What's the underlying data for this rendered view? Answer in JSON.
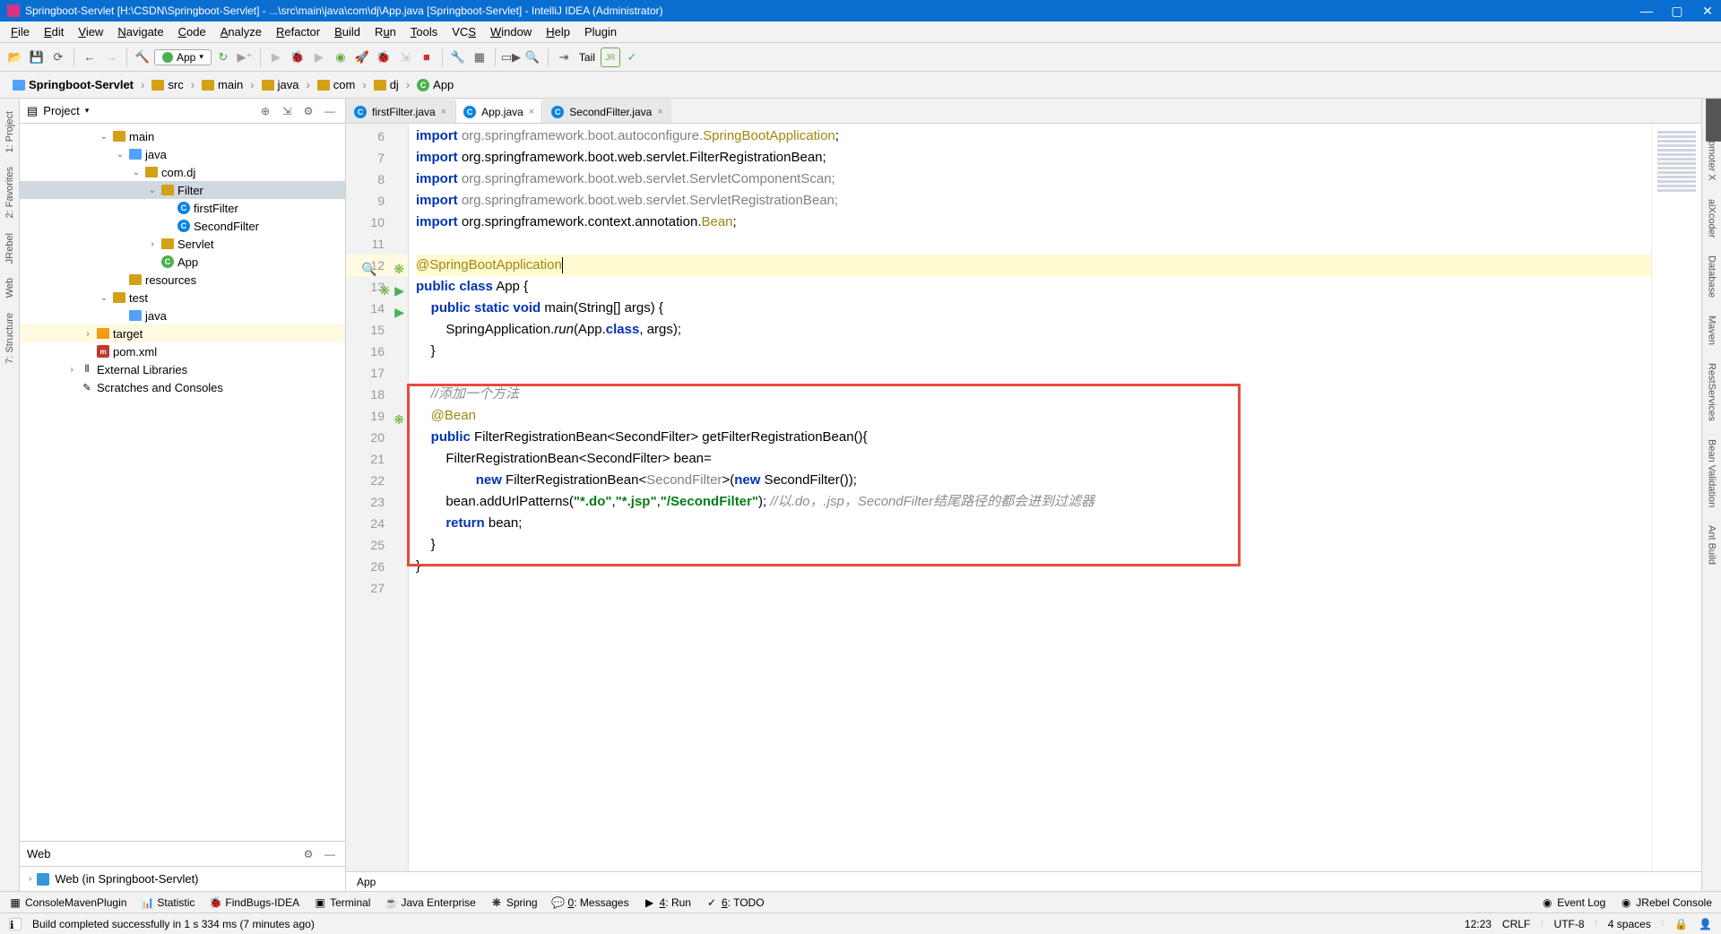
{
  "titlebar": {
    "title": "Springboot-Servlet [H:\\CSDN\\Springboot-Servlet] - ...\\src\\main\\java\\com\\dj\\App.java [Springboot-Servlet] - IntelliJ IDEA (Administrator)"
  },
  "menu": [
    "File",
    "Edit",
    "View",
    "Navigate",
    "Code",
    "Analyze",
    "Refactor",
    "Build",
    "Run",
    "Tools",
    "VCS",
    "Window",
    "Help",
    "Plugin"
  ],
  "menu_underlines": [
    0,
    0,
    0,
    0,
    0,
    0,
    0,
    0,
    1,
    0,
    2,
    0,
    0,
    -1
  ],
  "toolbar": {
    "run_config": "App",
    "tail": "Tail"
  },
  "breadcrumb": [
    "Springboot-Servlet",
    "src",
    "main",
    "java",
    "com",
    "dj",
    "App"
  ],
  "project_panel": {
    "title": "Project",
    "tree": [
      {
        "depth": 0,
        "chev": "v",
        "icon": "folder",
        "label": "main"
      },
      {
        "depth": 1,
        "chev": "v",
        "icon": "folder-blue",
        "label": "java"
      },
      {
        "depth": 2,
        "chev": "v",
        "icon": "folder",
        "label": "com.dj"
      },
      {
        "depth": 3,
        "chev": "v",
        "icon": "folder",
        "label": "Filter",
        "selected": true
      },
      {
        "depth": 4,
        "chev": "",
        "icon": "class",
        "label": "firstFilter"
      },
      {
        "depth": 4,
        "chev": "",
        "icon": "class",
        "label": "SecondFilter"
      },
      {
        "depth": 3,
        "chev": ">",
        "icon": "folder",
        "label": "Servlet"
      },
      {
        "depth": 3,
        "chev": "",
        "icon": "class-g",
        "label": "App"
      },
      {
        "depth": 1,
        "chev": "",
        "icon": "folder",
        "label": "resources"
      },
      {
        "depth": 0,
        "chev": "v",
        "icon": "folder",
        "label": "test"
      },
      {
        "depth": 1,
        "chev": "",
        "icon": "folder-blue",
        "label": "java"
      },
      {
        "depth": -1,
        "chev": ">",
        "icon": "folder-orange",
        "label": "target",
        "seltint": true
      },
      {
        "depth": -1,
        "chev": "",
        "icon": "maven",
        "label": "pom.xml"
      },
      {
        "depth": -2,
        "chev": ">",
        "icon": "lib",
        "label": "External Libraries"
      },
      {
        "depth": -2,
        "chev": "",
        "icon": "scratch",
        "label": "Scratches and Consoles"
      }
    ],
    "web_title": "Web",
    "web_item": "Web (in Springboot-Servlet)"
  },
  "left_rail": [
    "1: Project",
    "2: Favorites",
    "JRebel",
    "Web",
    "7: Structure"
  ],
  "right_rail": [
    "Key Promoter X",
    "aiXcoder",
    "Database",
    "Maven",
    "RestServices",
    "Bean Validation",
    "Ant Build"
  ],
  "editor": {
    "tabs": [
      {
        "label": "firstFilter.java",
        "active": false
      },
      {
        "label": "App.java",
        "active": true
      },
      {
        "label": "SecondFilter.java",
        "active": false
      }
    ],
    "first_line": 6,
    "lines": [
      {
        "n": 6,
        "html": "<span class='kw'>import</span> <span class='unused'>org.springframework.boot.autoconfigure.</span><span class='ann'>SpringBootApplication</span>;"
      },
      {
        "n": 7,
        "html": "<span class='kw'>import</span> org.springframework.boot.web.servlet.FilterRegistrationBean;"
      },
      {
        "n": 8,
        "html": "<span class='kw'>import</span> <span class='unused'>org.springframework.boot.web.servlet.ServletComponentScan;</span>"
      },
      {
        "n": 9,
        "html": "<span class='kw'>import</span> <span class='unused'>org.springframework.boot.web.servlet.ServletRegistrationBean;</span>"
      },
      {
        "n": 10,
        "html": "<span class='kw'>import</span> org.springframework.context.annotation.<span class='ann'>Bean</span>;"
      },
      {
        "n": 11,
        "html": ""
      },
      {
        "n": 12,
        "html": "<span class='ann'>@SpringBootApplication</span><span class='caret'></span>",
        "hl": true,
        "gut": "lens spring"
      },
      {
        "n": 13,
        "html": "<span class='kw'>public class</span> App {",
        "gut": "spring run"
      },
      {
        "n": 14,
        "html": "    <span class='kw'>public static void</span> main(String[] args) {",
        "gut": "run"
      },
      {
        "n": 15,
        "html": "        SpringApplication.<span class='italic-call'>run</span>(App.<span class='kw'>class</span>, args);"
      },
      {
        "n": 16,
        "html": "    }"
      },
      {
        "n": 17,
        "html": ""
      },
      {
        "n": 18,
        "html": "    <span class='cmt'>//添加一个方法</span>"
      },
      {
        "n": 19,
        "html": "    <span class='ann'>@Bean</span>",
        "gut": "spring"
      },
      {
        "n": 20,
        "html": "    <span class='kw'>public</span> FilterRegistrationBean&lt;SecondFilter&gt; getFilterRegistrationBean(){"
      },
      {
        "n": 21,
        "html": "        FilterRegistrationBean&lt;SecondFilter&gt; bean="
      },
      {
        "n": 22,
        "html": "                <span class='kw'>new</span> FilterRegistrationBean&lt;<span class='unused'>SecondFilter</span>&gt;(<span class='kw'>new</span> SecondFilter());"
      },
      {
        "n": 23,
        "html": "        bean.addUrlPatterns(<span class='str'>\"*.do\"</span>,<span class='str'>\"*.jsp\"</span>,<span class='str'>\"/SecondFilter\"</span>); <span class='cmt'>//以.do，.jsp，SecondFilter结尾路径的都会进到过滤器</span>"
      },
      {
        "n": 24,
        "html": "        <span class='kw'>return</span> bean;"
      },
      {
        "n": 25,
        "html": "    }"
      },
      {
        "n": 26,
        "html": "}"
      },
      {
        "n": 27,
        "html": ""
      }
    ],
    "crumb": "App"
  },
  "bottom_bar": [
    "ConsoleMavenPlugin",
    "Statistic",
    "FindBugs-IDEA",
    "Terminal",
    "Java Enterprise",
    "Spring",
    "0: Messages",
    "4: Run",
    "6: TODO"
  ],
  "bottom_bar_right": [
    "Event Log",
    "JRebel Console"
  ],
  "status": {
    "msg": "Build completed successfully in 1 s 334 ms (7 minutes ago)",
    "line_col": "12:23",
    "sep": "CRLF",
    "enc": "UTF-8",
    "indent": "4 spaces"
  }
}
